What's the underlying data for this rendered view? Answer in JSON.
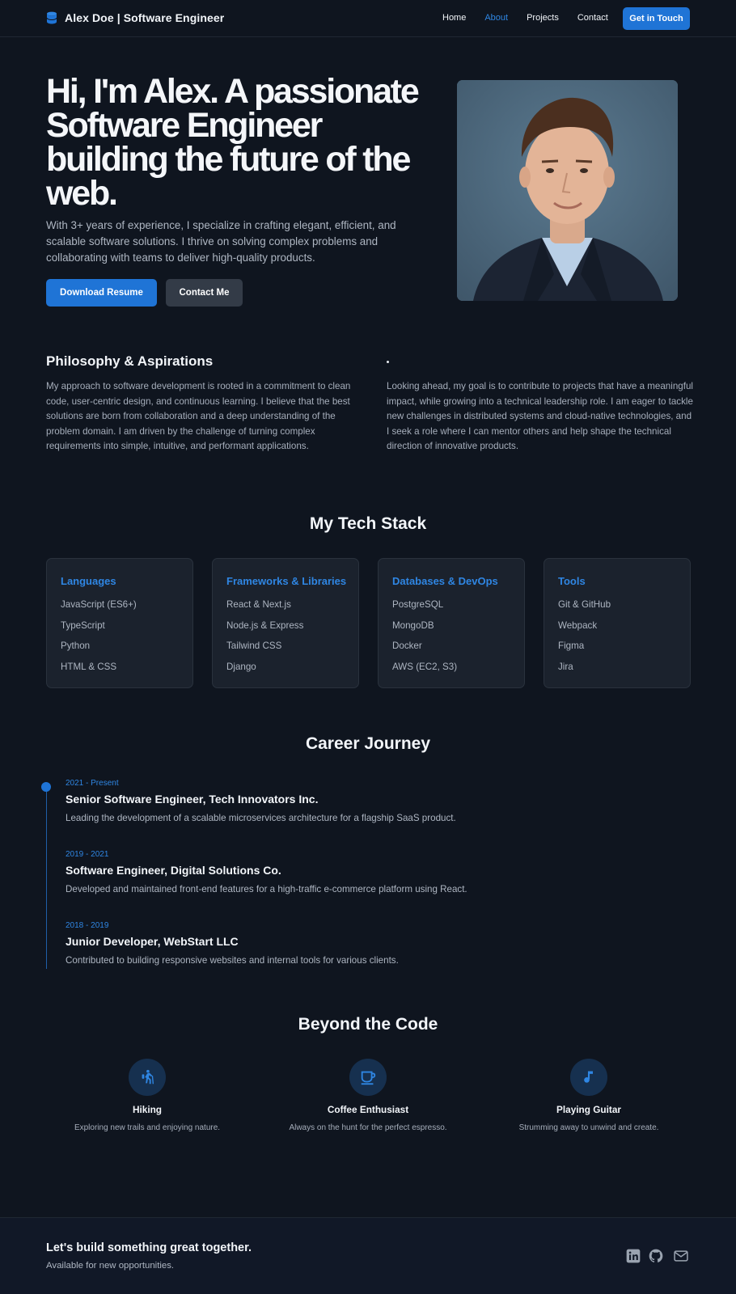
{
  "header": {
    "brand": "Alex Doe | Software Engineer",
    "nav": [
      {
        "label": "Home",
        "active": false
      },
      {
        "label": "About",
        "active": true
      },
      {
        "label": "Projects",
        "active": false
      },
      {
        "label": "Contact",
        "active": false
      }
    ],
    "cta": "Get in Touch"
  },
  "hero": {
    "title": "Hi, I'm Alex. A passionate Software Engineer building the future of the web.",
    "description": "With 3+ years of experience, I specialize in crafting elegant, efficient, and scalable software solutions. I thrive on solving complex problems and collaborating with teams to deliver high-quality products.",
    "primary_button": "Download Resume",
    "secondary_button": "Contact Me"
  },
  "philosophy": {
    "title": "Philosophy & Aspirations",
    "left_text": "My approach to software development is rooted in a commitment to clean code, user-centric design, and continuous learning. I believe that the best solutions are born from collaboration and a deep understanding of the problem domain. I am driven by the challenge of turning complex requirements into simple, intuitive, and performant applications.",
    "right_text": "Looking ahead, my goal is to contribute to projects that have a meaningful impact, while growing into a technical leadership role. I am eager to tackle new challenges in distributed systems and cloud-native technologies, and I seek a role where I can mentor others and help shape the technical direction of innovative products."
  },
  "tech_stack": {
    "title": "My Tech Stack",
    "cards": [
      {
        "title": "Languages",
        "items": [
          "JavaScript (ES6+)",
          "TypeScript",
          "Python",
          "HTML & CSS"
        ]
      },
      {
        "title": "Frameworks & Libraries",
        "items": [
          "React & Next.js",
          "Node.js & Express",
          "Tailwind CSS",
          "Django"
        ]
      },
      {
        "title": "Databases & DevOps",
        "items": [
          "PostgreSQL",
          "MongoDB",
          "Docker",
          "AWS (EC2, S3)"
        ]
      },
      {
        "title": "Tools",
        "items": [
          "Git & GitHub",
          "Webpack",
          "Figma",
          "Jira"
        ]
      }
    ]
  },
  "career": {
    "title": "Career Journey",
    "jobs": [
      {
        "date": "2021 - Present",
        "title": "Senior Software Engineer, Tech Innovators Inc.",
        "desc": "Leading the development of a scalable microservices architecture for a flagship SaaS product."
      },
      {
        "date": "2019 - 2021",
        "title": "Software Engineer, Digital Solutions Co.",
        "desc": "Developed and maintained front-end features for a high-traffic e-commerce platform using React."
      },
      {
        "date": "2018 - 2019",
        "title": "Junior Developer, WebStart LLC",
        "desc": "Contributed to building responsive websites and internal tools for various clients."
      }
    ]
  },
  "beyond": {
    "title": "Beyond the Code",
    "hobbies": [
      {
        "icon": "hiking-icon",
        "name": "Hiking",
        "desc": "Exploring new trails and enjoying nature."
      },
      {
        "icon": "coffee-icon",
        "name": "Coffee Enthusiast",
        "desc": "Always on the hunt for the perfect espresso."
      },
      {
        "icon": "music-note-icon",
        "name": "Playing Guitar",
        "desc": "Strumming away to unwind and create."
      }
    ]
  },
  "footer": {
    "title": "Let's build something great together.",
    "subtitle": "Available for new opportunities.",
    "social": [
      "linkedin-icon",
      "github-icon",
      "mail-icon"
    ]
  },
  "colors": {
    "background": "#0f151f",
    "accent": "#1f74d6",
    "card": "#1b222d"
  }
}
